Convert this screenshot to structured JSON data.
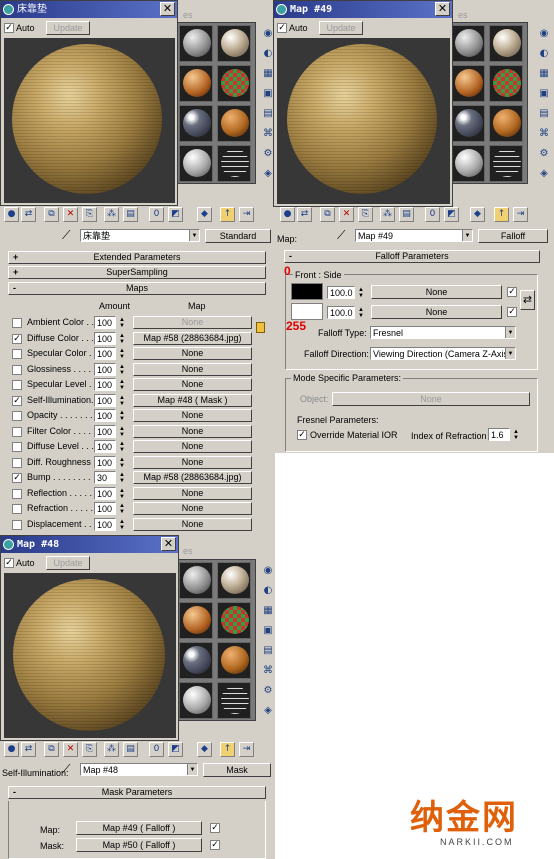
{
  "brand": {
    "name": "纳金网",
    "domain": "NARKII.COM",
    "color": "#e0600a"
  },
  "win1": {
    "title": "床靠垫",
    "auto_label": "Auto",
    "update_label": "Update",
    "close_glyph": "✕",
    "material_name": "床靠垫",
    "type_button": "Standard"
  },
  "rollouts": {
    "extended": "Extended Parameters",
    "supersampling": "SuperSampling",
    "maps": "Maps"
  },
  "maps_table": {
    "amount_header": "Amount",
    "map_header": "Map",
    "rows": [
      {
        "label": "Ambient Color . .",
        "checked": false,
        "amount": "100",
        "map": "None",
        "disabled": true
      },
      {
        "label": "Diffuse Color . . .",
        "checked": true,
        "amount": "100",
        "map": "Map #58 (28863684.jpg)"
      },
      {
        "label": "Specular Color . .",
        "checked": false,
        "amount": "100",
        "map": "None"
      },
      {
        "label": "Glossiness . . . . .",
        "checked": false,
        "amount": "100",
        "map": "None"
      },
      {
        "label": "Specular Level . .",
        "checked": false,
        "amount": "100",
        "map": "None"
      },
      {
        "label": "Self-Illumination. .",
        "checked": true,
        "amount": "100",
        "map": "Map #48  ( Mask )"
      },
      {
        "label": "Opacity . . . . . . .",
        "checked": false,
        "amount": "100",
        "map": "None"
      },
      {
        "label": "Filter Color . . . .",
        "checked": false,
        "amount": "100",
        "map": "None"
      },
      {
        "label": "Diffuse Level . . .",
        "checked": false,
        "amount": "100",
        "map": "None"
      },
      {
        "label": "Diff. Roughness .",
        "checked": false,
        "amount": "100",
        "map": "None"
      },
      {
        "label": "Bump . . . . . . . .",
        "checked": true,
        "amount": "30",
        "map": "Map #58 (28863684.jpg)"
      },
      {
        "label": "Reflection . . . . .",
        "checked": false,
        "amount": "100",
        "map": "None"
      },
      {
        "label": "Refraction . . . . .",
        "checked": false,
        "amount": "100",
        "map": "None"
      },
      {
        "label": "Displacement . . .",
        "checked": false,
        "amount": "100",
        "map": "None"
      }
    ]
  },
  "win2": {
    "title": "Map #49",
    "auto_label": "Auto",
    "update_label": "Update",
    "close_glyph": "✕",
    "map_label": "Map:",
    "map_name": "Map #49",
    "type_button": "Falloff"
  },
  "falloff": {
    "rollout": "Falloff Parameters",
    "front_side": "Front : Side",
    "anno_0": "0",
    "anno_255": "255",
    "row1": {
      "value": "100.0",
      "map": "None",
      "color": "#000000"
    },
    "row2": {
      "value": "100.0",
      "map": "None",
      "color": "#ffffff"
    },
    "falloff_type_label": "Falloff Type:",
    "falloff_type": "Fresnel",
    "falloff_direction_label": "Falloff Direction:",
    "falloff_direction": "Viewing Direction (Camera Z-Axis)",
    "mode_specific": "Mode Specific Parameters:",
    "object_label": "Object:",
    "object_value": "None",
    "fresnel_params": "Fresnel Parameters:",
    "override_ior": "Override Material IOR",
    "ior_label": "Index of Refraction",
    "ior_value": "1.6"
  },
  "win3": {
    "title": "Map #48",
    "auto_label": "Auto",
    "update_label": "Update",
    "close_glyph": "✕",
    "slot_label": "Self-Illumination:",
    "map_name": "Map #48",
    "type_button": "Mask"
  },
  "mask": {
    "rollout": "Mask Parameters",
    "map_label": "Map:",
    "map_value": "Map #49  ( Falloff )",
    "mask_label": "Mask:",
    "mask_value": "Map #50  ( Falloff )"
  },
  "partial_text": "es"
}
